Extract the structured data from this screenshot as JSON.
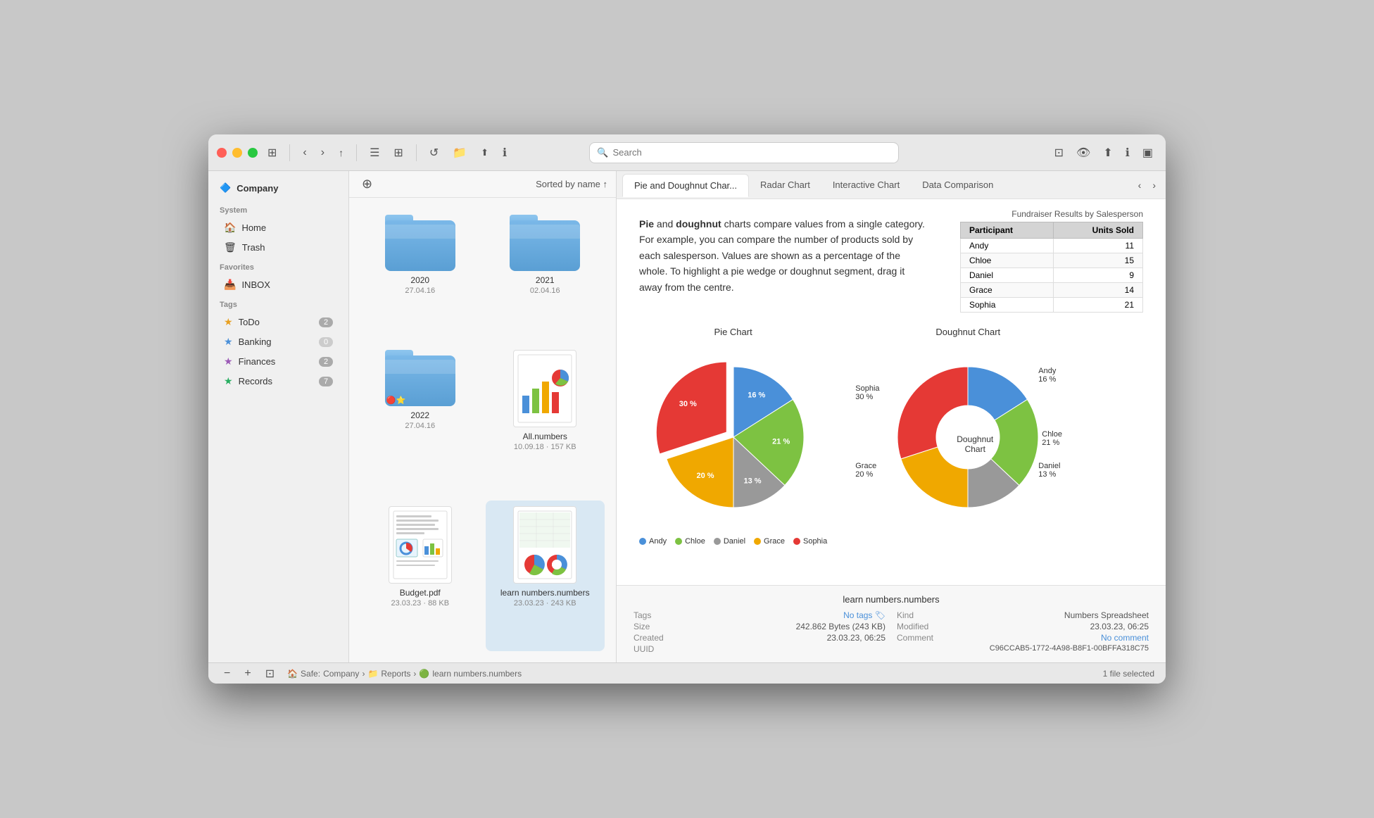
{
  "window": {
    "title": "Company"
  },
  "titlebar": {
    "back_label": "‹",
    "forward_label": "›",
    "up_label": "↑",
    "list_view_icon": "☰",
    "grid_view_icon": "⊞",
    "refresh_icon": "↺",
    "folder_icon": "📁",
    "share_icon": "⬆",
    "info_icon": "ℹ",
    "search_placeholder": "Search",
    "sidebar_toggle_icon": "▣"
  },
  "sidebar": {
    "company_label": "Company",
    "system_label": "System",
    "home_label": "Home",
    "trash_label": "Trash",
    "favorites_label": "Favorites",
    "inbox_label": "INBOX",
    "tags_label": "Tags",
    "tags": [
      {
        "name": "ToDo",
        "color": "#e8a020",
        "count": "2"
      },
      {
        "name": "Banking",
        "color": "#4a90d9",
        "count": "0"
      },
      {
        "name": "Finances",
        "color": "#9b59b6",
        "count": "2"
      },
      {
        "name": "Records",
        "color": "#27ae60",
        "count": "7"
      }
    ]
  },
  "file_browser": {
    "sort_label": "Sorted by name ↑",
    "add_icon": "+",
    "files": [
      {
        "type": "folder",
        "name": "2020",
        "date": "27.04.16",
        "badge": ""
      },
      {
        "type": "folder",
        "name": "2021",
        "date": "02.04.16",
        "badge": ""
      },
      {
        "type": "folder",
        "name": "2022",
        "date": "27.04.16",
        "badge": "🔴⭐"
      },
      {
        "type": "doc",
        "name": "All.numbers",
        "date": "10.09.18 · 157 KB",
        "badge": ""
      },
      {
        "type": "pdf",
        "name": "Budget.pdf",
        "date": "23.03.23 · 88 KB",
        "badge": ""
      },
      {
        "type": "numbers",
        "name": "learn numbers.numbers",
        "date": "23.03.23 · 243 KB",
        "badge": "",
        "selected": true
      }
    ]
  },
  "tabs": [
    {
      "label": "Pie and Doughnut Char...",
      "active": true
    },
    {
      "label": "Radar Chart"
    },
    {
      "label": "Interactive Chart"
    },
    {
      "label": "Data Comparison"
    }
  ],
  "preview": {
    "description_part1": "Pie",
    "description_part2": " and ",
    "description_bold": "doughnut",
    "description_rest": " charts compare values from a single category. For example, you can compare the number of products sold by each salesperson. Values are shown as a percentage of the whole. To highlight a pie wedge or doughnut segment, drag it away from the centre.",
    "table": {
      "caption": "Fundraiser Results by Salesperson",
      "headers": [
        "Participant",
        "Units Sold"
      ],
      "rows": [
        {
          "name": "Andy",
          "value": 11
        },
        {
          "name": "Chloe",
          "value": 15
        },
        {
          "name": "Daniel",
          "value": 9
        },
        {
          "name": "Grace",
          "value": 14
        },
        {
          "name": "Sophia",
          "value": 21
        }
      ]
    },
    "pie_chart": {
      "title": "Pie Chart",
      "segments": [
        {
          "name": "Andy",
          "pct": 16,
          "color": "#4a90d9"
        },
        {
          "name": "Chloe",
          "pct": 21,
          "color": "#7dc242"
        },
        {
          "name": "Daniel",
          "pct": 13,
          "color": "#999"
        },
        {
          "name": "Grace",
          "pct": 20,
          "color": "#f0a800"
        },
        {
          "name": "Sophia",
          "pct": 30,
          "color": "#e53935"
        }
      ]
    },
    "doughnut_chart": {
      "title": "Doughnut Chart",
      "segments": [
        {
          "name": "Andy",
          "pct": 16,
          "color": "#4a90d9"
        },
        {
          "name": "Chloe",
          "pct": 21,
          "color": "#7dc242"
        },
        {
          "name": "Daniel",
          "pct": 13,
          "color": "#999"
        },
        {
          "name": "Grace",
          "pct": 20,
          "color": "#f0a800"
        },
        {
          "name": "Sophia",
          "pct": 30,
          "color": "#e53935"
        }
      ],
      "labels": [
        {
          "name": "Andy",
          "pct": "16 %",
          "side": "right",
          "topPct": 15
        },
        {
          "name": "Sophia",
          "pct": "30 %",
          "side": "left",
          "topPct": 32
        },
        {
          "name": "Chloe",
          "pct": "21 %",
          "side": "right",
          "topPct": 52
        },
        {
          "name": "Grace",
          "pct": "20 %",
          "side": "left",
          "topPct": 72
        },
        {
          "name": "Daniel",
          "pct": "13 %",
          "side": "right",
          "topPct": 72
        }
      ]
    }
  },
  "file_info": {
    "filename": "learn numbers.numbers",
    "tags_label": "Tags",
    "tags_value": "No tags",
    "kind_label": "Kind",
    "kind_value": "Numbers Spreadsheet",
    "size_label": "Size",
    "size_value": "242.862 Bytes (243 KB)",
    "modified_label": "Modified",
    "modified_value": "23.03.23, 06:25",
    "created_label": "Created",
    "created_value": "23.03.23, 06:25",
    "comment_label": "Comment",
    "comment_value": "No comment",
    "uuid_label": "UUID",
    "uuid_value": "C96CCAB5-1772-4A98-B8F1-00BFFA318C75"
  },
  "status_bar": {
    "safe_label": "Safe:",
    "company_label": "Company",
    "arrow": "›",
    "reports_label": "Reports",
    "file_label": "learn numbers.numbers",
    "file_count": "1 file selected",
    "zoom_in": "+",
    "zoom_out": "−"
  }
}
